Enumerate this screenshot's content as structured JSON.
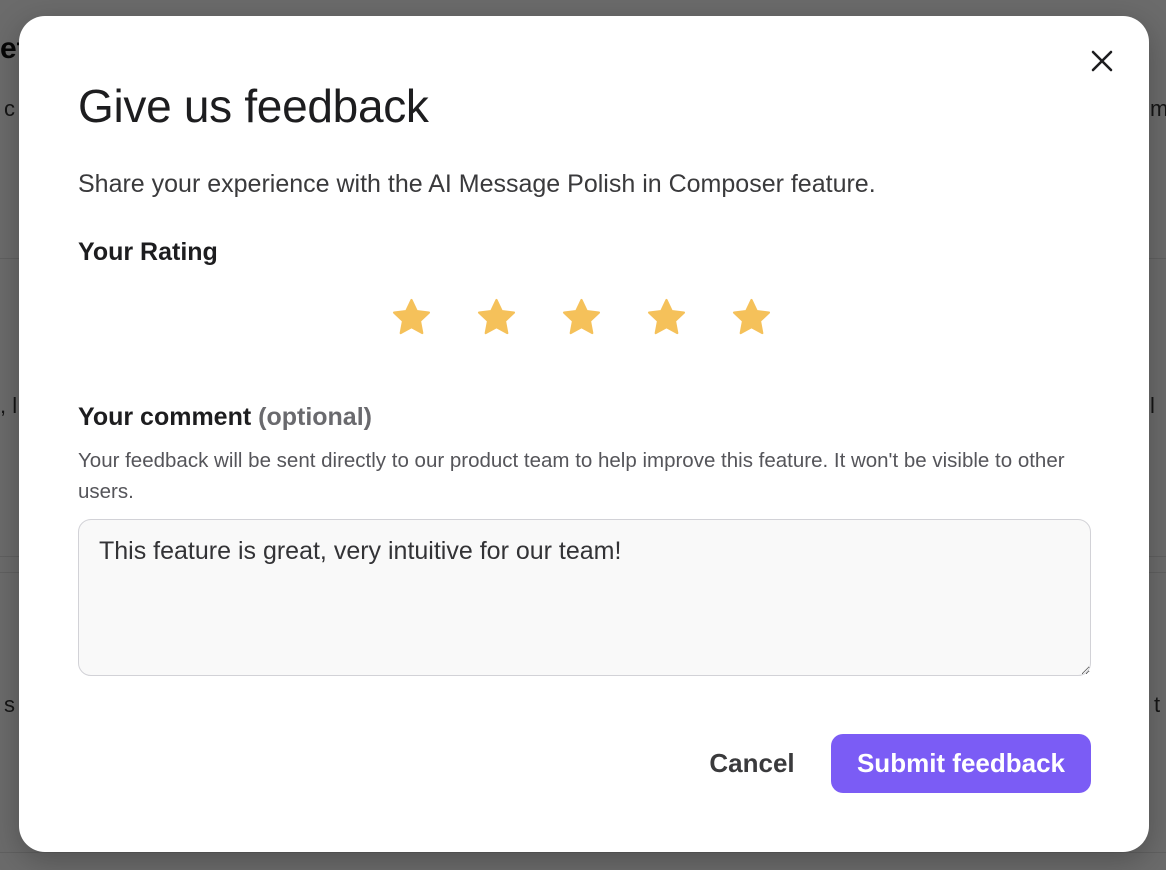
{
  "background": {
    "fragments": [
      "et",
      "c",
      "m",
      ", l",
      "l",
      "s",
      "t"
    ]
  },
  "modal": {
    "title": "Give us feedback",
    "subtitle": "Share your experience with the AI Message Polish in Composer feature.",
    "close_icon": "close-icon",
    "rating": {
      "label": "Your Rating",
      "value": 5,
      "max": 5,
      "star_color": "#f5c15a",
      "star_icon": "star-icon"
    },
    "comment": {
      "label": "Your comment",
      "optional_label": "(optional)",
      "help_text": "Your feedback will be sent directly to our product team to help improve this feature. It won't be visible to other users.",
      "value": "This feature is great, very intuitive for our team!"
    },
    "buttons": {
      "cancel_label": "Cancel",
      "submit_label": "Submit feedback",
      "submit_color": "#7b5cf5"
    }
  }
}
